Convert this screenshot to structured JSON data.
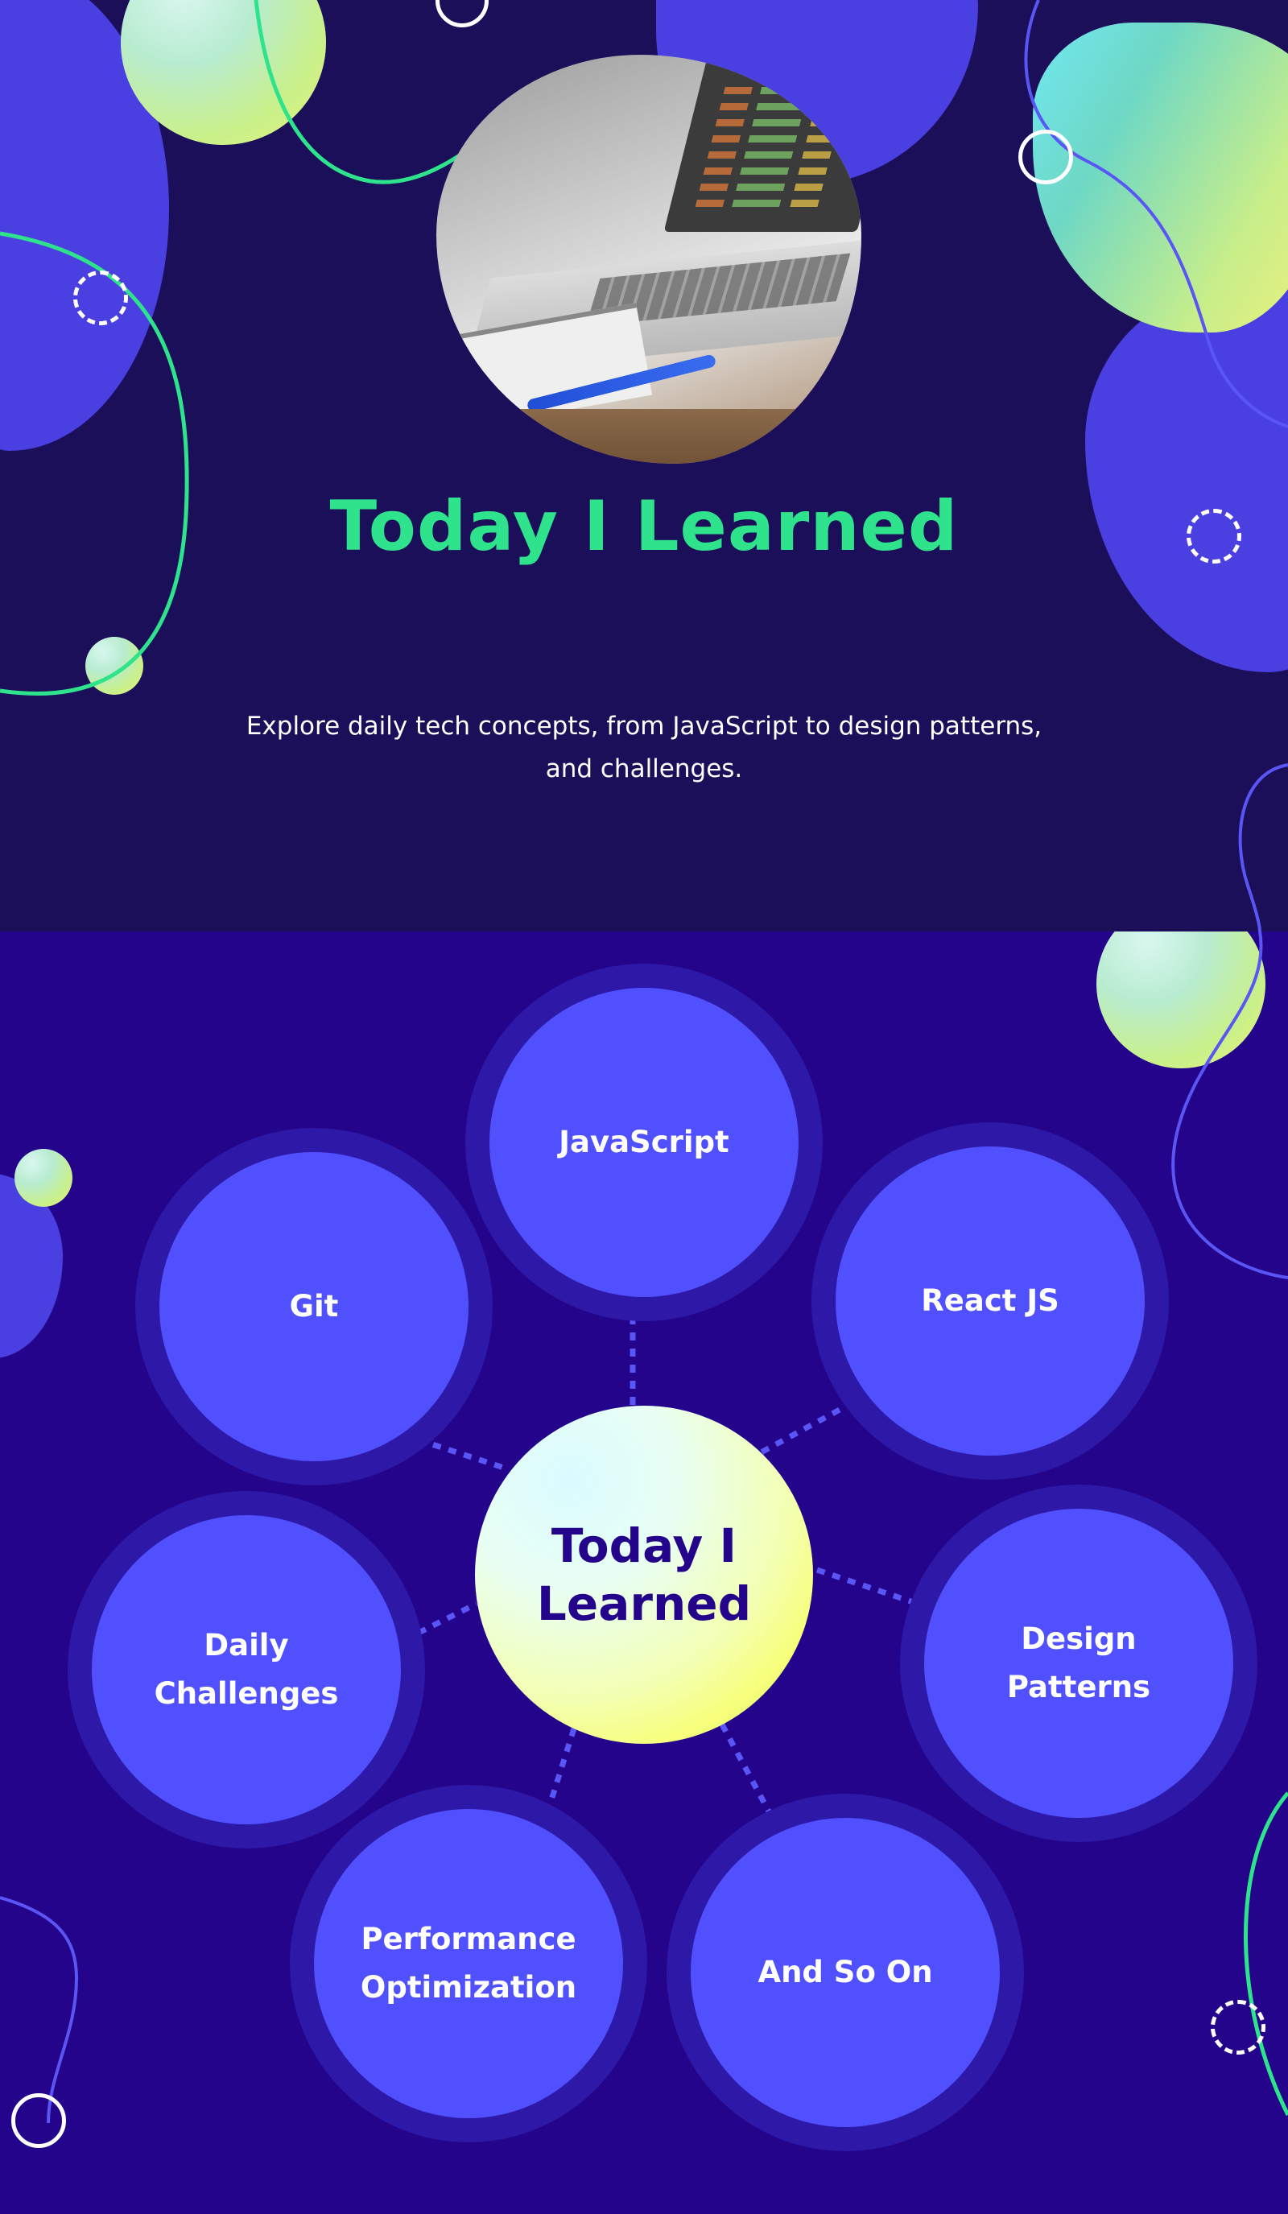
{
  "hero": {
    "title": "Today I Learned",
    "subtitle": "Explore daily tech concepts, from JavaScript to design patterns, and challenges.",
    "image_alt": "laptop with notebook and pen"
  },
  "hub": {
    "title": "Today I\nLearned"
  },
  "topics": [
    {
      "id": "javascript",
      "label": "JavaScript"
    },
    {
      "id": "git",
      "label": "Git"
    },
    {
      "id": "react",
      "label": "React JS"
    },
    {
      "id": "daily-challenges",
      "label": "Daily\nChallenges"
    },
    {
      "id": "design-patterns",
      "label": "Design\nPatterns"
    },
    {
      "id": "performance",
      "label": "Performance\nOptimization"
    },
    {
      "id": "and-so-on",
      "label": "And So On"
    }
  ],
  "colors": {
    "hero_bg": "#1b0f5a",
    "topics_bg": "#23048a",
    "accent_green": "#2ee38c",
    "node_fill": "#5050ff",
    "node_ring": "#2d18a8",
    "blob": "#4a3fe0"
  }
}
